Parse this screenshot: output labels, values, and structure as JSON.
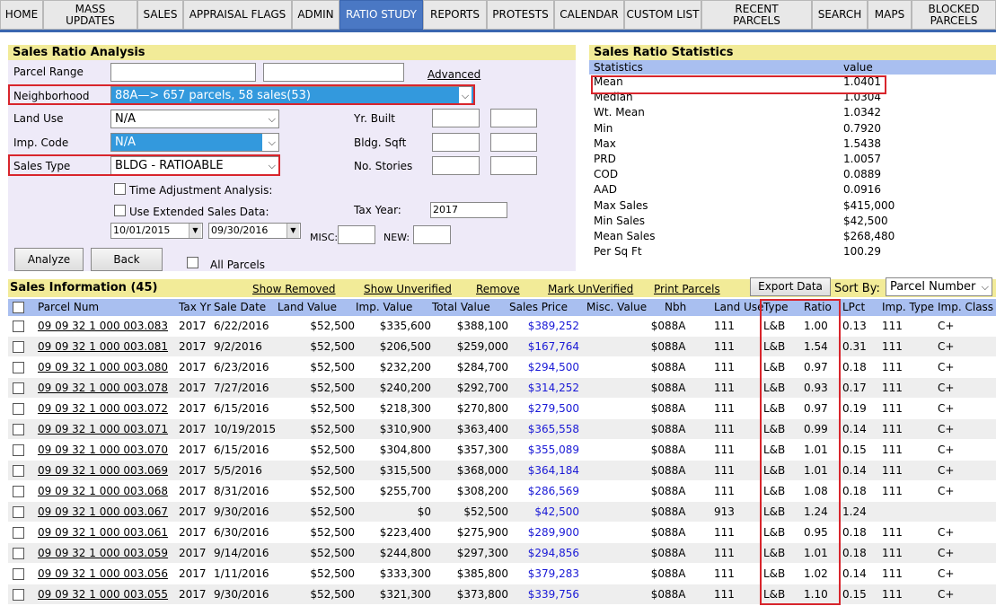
{
  "nav": {
    "items": [
      {
        "label": "HOME",
        "w": 48
      },
      {
        "label": "MASS\nUPDATES",
        "w": 105
      },
      {
        "label": "SALES",
        "w": 51
      },
      {
        "label": "APPRAISAL FLAGS",
        "w": 121
      },
      {
        "label": "ADMIN",
        "w": 53
      },
      {
        "label": "RATIO STUDY",
        "w": 93
      },
      {
        "label": "REPORTS",
        "w": 71
      },
      {
        "label": "PROTESTS",
        "w": 75
      },
      {
        "label": "CALENDAR",
        "w": 78
      },
      {
        "label": "CUSTOM LIST",
        "w": 86
      },
      {
        "label": "RECENT\nPARCELS",
        "w": 123
      },
      {
        "label": "SEARCH",
        "w": 62
      },
      {
        "label": "MAPS",
        "w": 49
      },
      {
        "label": "BLOCKED\nPARCELS",
        "w": 94
      }
    ],
    "active": "RATIO STUDY"
  },
  "analysis": {
    "title": "Sales Ratio Analysis",
    "parcel_range_label": "Parcel Range",
    "advanced_link": "Advanced",
    "neighborhood_label": "Neighborhood",
    "neighborhood_value": "88A—> 657 parcels, 58 sales(53)",
    "land_use_label": "Land Use",
    "land_use_value": "N/A",
    "imp_code_label": "Imp. Code",
    "imp_code_value": "N/A",
    "sales_type_label": "Sales Type",
    "sales_type_value": "BLDG - RATIOABLE",
    "yr_built_label": "Yr. Built",
    "bldg_sqft_label": "Bldg. Sqft",
    "no_stories_label": "No. Stories",
    "time_adj_label": "Time Adjustment Analysis:",
    "ext_sales_label": "Use Extended Sales Data:",
    "tax_year_label": "Tax Year:",
    "tax_year_value": "2017",
    "date_from": "10/01/2015",
    "date_to": "09/30/2016",
    "misc_label": "MISC:",
    "new_label": "NEW:",
    "analyze_button": "Analyze",
    "back_button": "Back",
    "all_parcels_label": "All Parcels"
  },
  "stats": {
    "title": "Sales Ratio Statistics",
    "col_statistics": "Statistics",
    "col_value": "value",
    "rows": [
      {
        "name": "Mean",
        "value": "1.0401"
      },
      {
        "name": "Median",
        "value": "1.0304"
      },
      {
        "name": "Wt. Mean",
        "value": "1.0342"
      },
      {
        "name": "Min",
        "value": "0.7920"
      },
      {
        "name": "Max",
        "value": "1.5438"
      },
      {
        "name": "PRD",
        "value": "1.0057"
      },
      {
        "name": "COD",
        "value": "0.0889"
      },
      {
        "name": "AAD",
        "value": "0.0916"
      },
      {
        "name": "Max Sales",
        "value": "$415,000"
      },
      {
        "name": "Min Sales",
        "value": "$42,500"
      },
      {
        "name": "Mean Sales",
        "value": "$268,480"
      },
      {
        "name": "Per Sq Ft",
        "value": "100.29"
      }
    ]
  },
  "info": {
    "title": "Sales Information (45)",
    "links": [
      "Show Removed",
      "Show Unverified",
      "Remove",
      "Mark UnVerified",
      "Print Parcels"
    ],
    "export_button": "Export Data",
    "sort_label": "Sort By:",
    "sort_value": "Parcel Number",
    "headers": [
      "Parcel Num",
      "Tax Yr",
      "Sale Date",
      "Land Value",
      "Imp. Value",
      "Total Value",
      "Sales Price",
      "Misc. Value",
      "Nbh",
      "Land Use",
      "Type",
      "Ratio",
      "LPct",
      "Imp. Type",
      "Imp. Class"
    ],
    "rows": [
      [
        "09 09 32 1 000 003.083",
        "2017",
        "6/22/2016",
        "$52,500",
        "$335,600",
        "$388,100",
        "$389,252",
        "$0",
        "88A",
        "111",
        "L&B",
        "1.00",
        "0.13",
        "111",
        "C+"
      ],
      [
        "09 09 32 1 000 003.081",
        "2017",
        "9/2/2016",
        "$52,500",
        "$206,500",
        "$259,000",
        "$167,764",
        "$0",
        "88A",
        "111",
        "L&B",
        "1.54",
        "0.31",
        "111",
        "C+"
      ],
      [
        "09 09 32 1 000 003.080",
        "2017",
        "6/23/2016",
        "$52,500",
        "$232,200",
        "$284,700",
        "$294,500",
        "$0",
        "88A",
        "111",
        "L&B",
        "0.97",
        "0.18",
        "111",
        "C+"
      ],
      [
        "09 09 32 1 000 003.078",
        "2017",
        "7/27/2016",
        "$52,500",
        "$240,200",
        "$292,700",
        "$314,252",
        "$0",
        "88A",
        "111",
        "L&B",
        "0.93",
        "0.17",
        "111",
        "C+"
      ],
      [
        "09 09 32 1 000 003.072",
        "2017",
        "6/15/2016",
        "$52,500",
        "$218,300",
        "$270,800",
        "$279,500",
        "$0",
        "88A",
        "111",
        "L&B",
        "0.97",
        "0.19",
        "111",
        "C+"
      ],
      [
        "09 09 32 1 000 003.071",
        "2017",
        "10/19/2015",
        "$52,500",
        "$310,900",
        "$363,400",
        "$365,558",
        "$0",
        "88A",
        "111",
        "L&B",
        "0.99",
        "0.14",
        "111",
        "C+"
      ],
      [
        "09 09 32 1 000 003.070",
        "2017",
        "6/15/2016",
        "$52,500",
        "$304,800",
        "$357,300",
        "$355,089",
        "$0",
        "88A",
        "111",
        "L&B",
        "1.01",
        "0.15",
        "111",
        "C+"
      ],
      [
        "09 09 32 1 000 003.069",
        "2017",
        "5/5/2016",
        "$52,500",
        "$315,500",
        "$368,000",
        "$364,184",
        "$0",
        "88A",
        "111",
        "L&B",
        "1.01",
        "0.14",
        "111",
        "C+"
      ],
      [
        "09 09 32 1 000 003.068",
        "2017",
        "8/31/2016",
        "$52,500",
        "$255,700",
        "$308,200",
        "$286,569",
        "$0",
        "88A",
        "111",
        "L&B",
        "1.08",
        "0.18",
        "111",
        "C+"
      ],
      [
        "09 09 32 1 000 003.067",
        "2017",
        "9/30/2016",
        "$52,500",
        "$0",
        "$52,500",
        "$42,500",
        "$0",
        "88A",
        "913",
        "L&B",
        "1.24",
        "1.24",
        "",
        ""
      ],
      [
        "09 09 32 1 000 003.061",
        "2017",
        "6/30/2016",
        "$52,500",
        "$223,400",
        "$275,900",
        "$289,900",
        "$0",
        "88A",
        "111",
        "L&B",
        "0.95",
        "0.18",
        "111",
        "C+"
      ],
      [
        "09 09 32 1 000 003.059",
        "2017",
        "9/14/2016",
        "$52,500",
        "$244,800",
        "$297,300",
        "$294,856",
        "$0",
        "88A",
        "111",
        "L&B",
        "1.01",
        "0.18",
        "111",
        "C+"
      ],
      [
        "09 09 32 1 000 003.056",
        "2017",
        "1/11/2016",
        "$52,500",
        "$333,300",
        "$385,800",
        "$379,283",
        "$0",
        "88A",
        "111",
        "L&B",
        "1.02",
        "0.14",
        "111",
        "C+"
      ],
      [
        "09 09 32 1 000 003.055",
        "2017",
        "9/30/2016",
        "$52,500",
        "$321,300",
        "$373,800",
        "$339,756",
        "$0",
        "88A",
        "111",
        "L&B",
        "1.10",
        "0.15",
        "111",
        "C+"
      ]
    ]
  }
}
